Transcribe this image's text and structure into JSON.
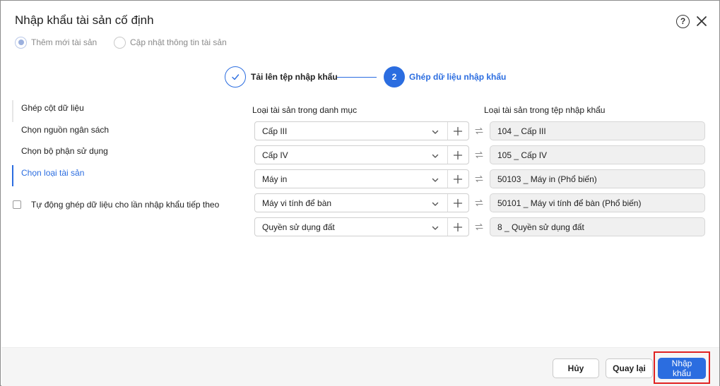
{
  "dialog": {
    "title": "Nhập khẩu tài sản cố định"
  },
  "modes": [
    {
      "label": "Thêm mới tài sản",
      "checked": true
    },
    {
      "label": "Cập nhật thông tin tài sản",
      "checked": false
    }
  ],
  "stepper": {
    "step1_label": "Tải lên tệp nhập khẩu",
    "step2_number": "2",
    "step2_label": "Ghép dữ liệu nhập khẩu"
  },
  "side_nav": [
    {
      "label": "Ghép cột dữ liệu",
      "active": false
    },
    {
      "label": "Chọn nguồn ngân sách",
      "active": false
    },
    {
      "label": "Chọn bộ phận sử dụng",
      "active": false
    },
    {
      "label": "Chọn loại tài sản",
      "active": true
    }
  ],
  "auto_match": {
    "label": "Tự động ghép dữ liệu cho lần nhập khẩu tiếp theo",
    "checked": false
  },
  "columns": {
    "catalog": "Loại tài sản trong danh mục",
    "file": "Loại tài sản trong tệp nhập khẩu"
  },
  "rows": [
    {
      "catalog_value": "Cấp III",
      "file_value": "104 _ Cấp III"
    },
    {
      "catalog_value": "Cấp IV",
      "file_value": "105 _ Cấp IV"
    },
    {
      "catalog_value": "Máy in",
      "file_value": "50103 _ Máy in (Phổ biến)"
    },
    {
      "catalog_value": "Máy vi tính để bàn",
      "file_value": "50101 _ Máy vi tính để bàn (Phổ biến)"
    },
    {
      "catalog_value": "Quyền sử dụng đất",
      "file_value": "8 _ Quyền sử dụng đất"
    }
  ],
  "footer": {
    "cancel_label": "Hủy",
    "back_label": "Quay lại",
    "import_label_line1": "Nhập",
    "import_label_line2": "khẩu"
  },
  "icons": {
    "help": "question-circle-icon",
    "close": "close-icon",
    "step1": "check-icon",
    "caret": "chevron-down-icon",
    "add": "plus-icon",
    "link": "swap-arrows-icon"
  },
  "colors": {
    "accent": "#2b6de0",
    "highlight": "#e02222"
  }
}
